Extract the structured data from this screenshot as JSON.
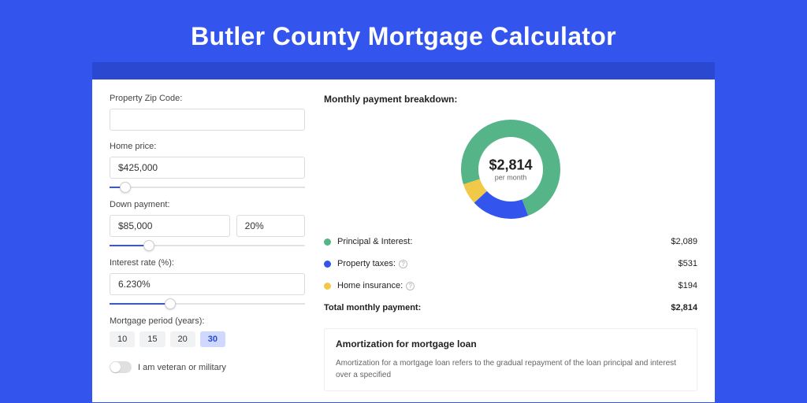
{
  "page_title": "Butler County Mortgage Calculator",
  "left": {
    "zip_label": "Property Zip Code:",
    "zip_value": "",
    "price_label": "Home price:",
    "price_value": "$425,000",
    "price_slider_pct": 8,
    "down_label": "Down payment:",
    "down_value": "$85,000",
    "down_pct": "20%",
    "down_slider_pct": 20,
    "rate_label": "Interest rate (%):",
    "rate_value": "6.230%",
    "rate_slider_pct": 31,
    "period_label": "Mortgage period (years):",
    "period_options": [
      "10",
      "15",
      "20",
      "30"
    ],
    "period_selected": "30",
    "toggle_label": "I am veteran or military"
  },
  "chart_data": {
    "type": "pie",
    "title": "Monthly payment breakdown:",
    "center_value": "$2,814",
    "center_sub": "per month",
    "series": [
      {
        "name": "Principal & Interest:",
        "value": 2089,
        "display": "$2,089",
        "color": "#56b588"
      },
      {
        "name": "Property taxes:",
        "value": 531,
        "display": "$531",
        "color": "#3355ee"
      },
      {
        "name": "Home insurance:",
        "value": 194,
        "display": "$194",
        "color": "#f1c948"
      }
    ],
    "total_label": "Total monthly payment:",
    "total_display": "$2,814"
  },
  "amort": {
    "title": "Amortization for mortgage loan",
    "text": "Amortization for a mortgage loan refers to the gradual repayment of the loan principal and interest over a specified"
  }
}
